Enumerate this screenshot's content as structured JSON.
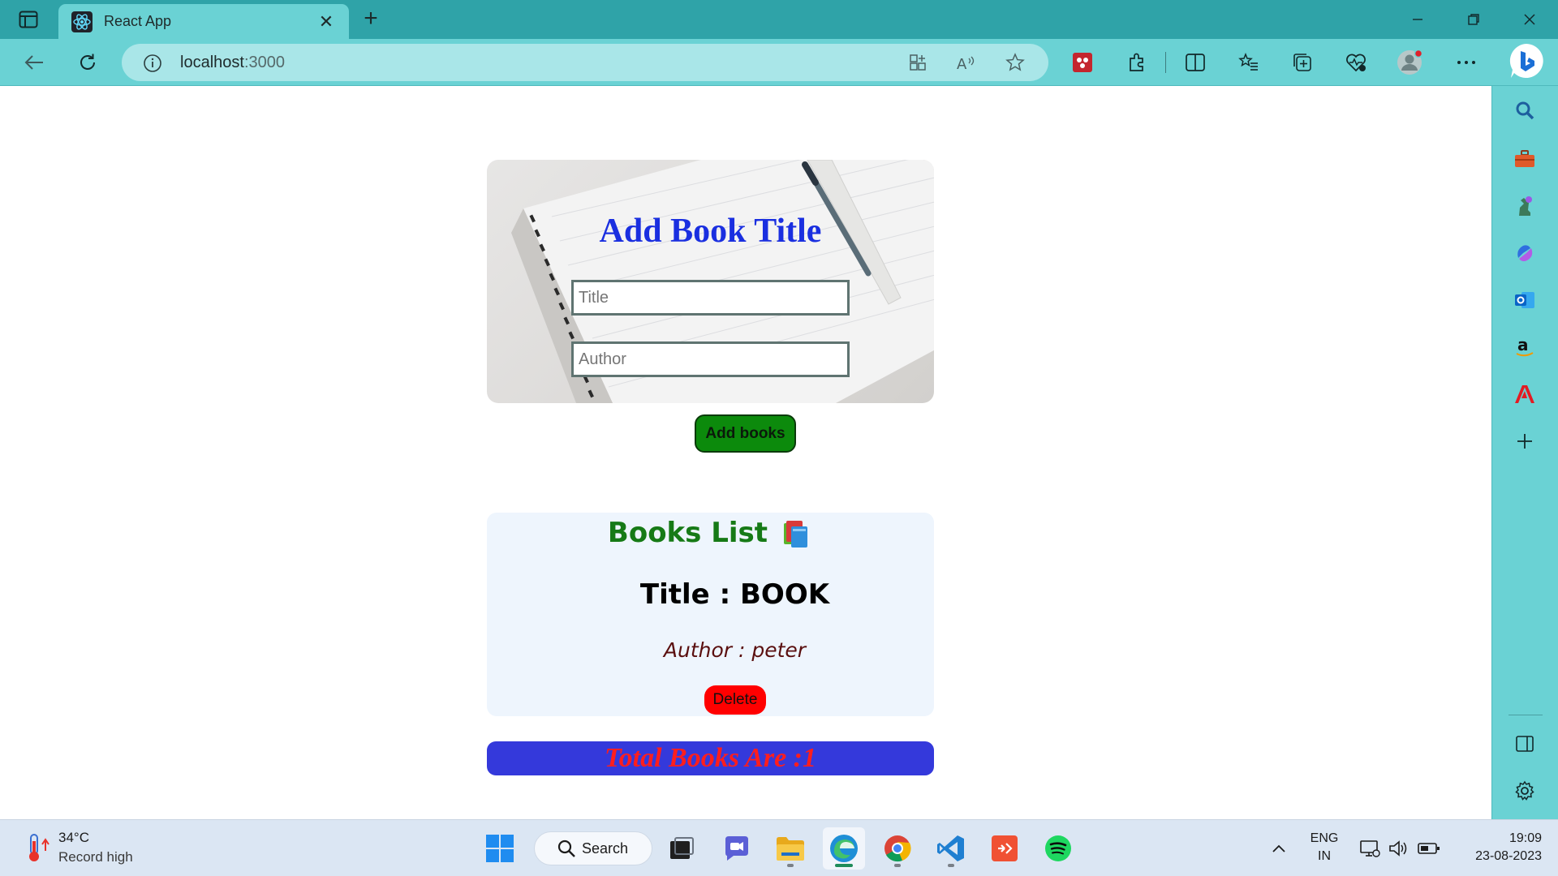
{
  "browser": {
    "tab_title": "React App",
    "url_host": "localhost",
    "url_port": ":3000"
  },
  "page": {
    "form": {
      "heading": "Add Book Title",
      "title_placeholder": "Title",
      "author_placeholder": "Author",
      "submit_label": "Add books"
    },
    "list": {
      "heading": "Books List",
      "books": [
        {
          "title_line": "Title : BOOK",
          "author_line": "Author : peter",
          "delete_label": "Delete"
        }
      ]
    },
    "total_text": "Total Books Are :1"
  },
  "taskbar": {
    "weather_temp": "34°C",
    "weather_desc": "Record high",
    "search_label": "Search",
    "lang_line1": "ENG",
    "lang_line2": "IN",
    "time": "19:09",
    "date": "23-08-2023"
  },
  "icons": {
    "edge_sidebar": [
      "search-icon",
      "toolbox-icon",
      "chess-icon",
      "copilot-icon",
      "outlook-icon",
      "amazon-icon",
      "adobe-icon",
      "add-icon"
    ],
    "taskbar_apps": [
      "windows-start-icon",
      "task-view-icon",
      "teams-chat-icon",
      "file-explorer-icon",
      "edge-icon",
      "chrome-icon",
      "vscode-icon",
      "git-icon",
      "spotify-icon"
    ]
  }
}
